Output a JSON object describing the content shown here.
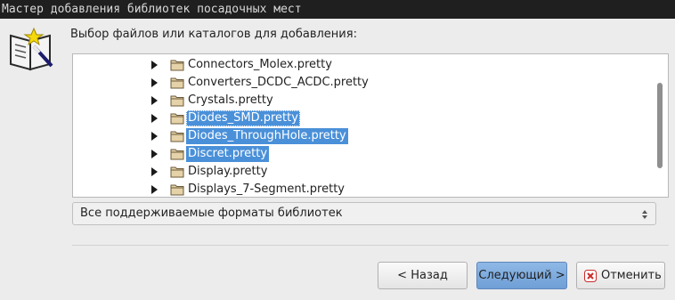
{
  "window": {
    "title": "Мастер добавления библиотек посадочных мест"
  },
  "icons": {
    "wizard": "book-wand-icon",
    "folder": "folder-icon",
    "expander": "triangle-right-icon",
    "cancel": "cancel-x-icon"
  },
  "prompt": "Выбор файлов или каталогов для добавления:",
  "tree": {
    "items": [
      {
        "label": "Connectors_Molex.pretty",
        "selected": false
      },
      {
        "label": "Converters_DCDC_ACDC.pretty",
        "selected": false
      },
      {
        "label": "Crystals.pretty",
        "selected": false
      },
      {
        "label": "Diodes_SMD.pretty",
        "selected": true
      },
      {
        "label": "Diodes_ThroughHole.pretty",
        "selected": true
      },
      {
        "label": "Discret.pretty",
        "selected": true
      },
      {
        "label": "Display.pretty",
        "selected": false
      },
      {
        "label": "Displays_7-Segment.pretty",
        "selected": false
      }
    ]
  },
  "filter": {
    "selected": "Все поддерживаемые форматы библиотек"
  },
  "buttons": {
    "back": "< Назад",
    "next": "Следующий >",
    "cancel": "Отменить"
  },
  "colors": {
    "selection": "#4a90d9",
    "titlebar": "#1f1f1f"
  }
}
